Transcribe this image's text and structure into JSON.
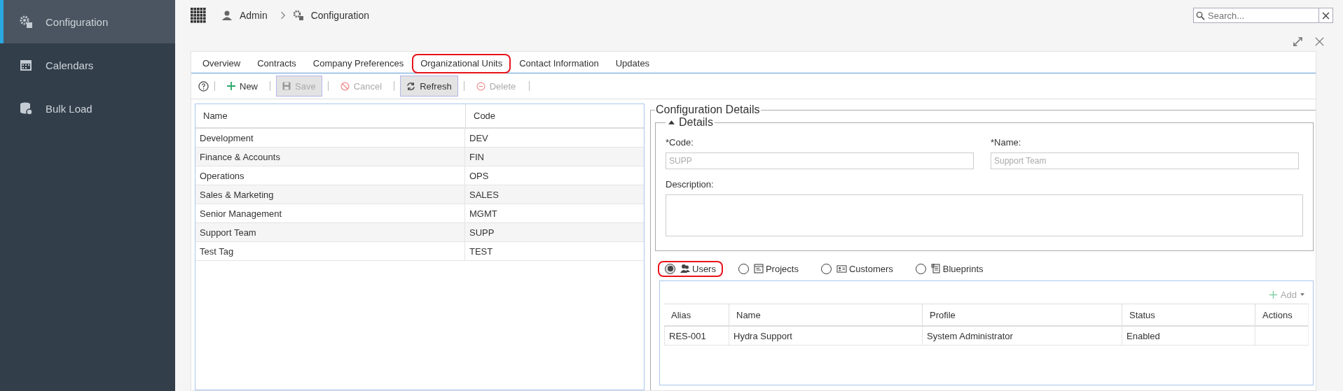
{
  "sidebar": {
    "items": [
      {
        "label": "Configuration",
        "selected": true
      },
      {
        "label": "Calendars",
        "selected": false
      },
      {
        "label": "Bulk Load",
        "selected": false
      }
    ]
  },
  "breadcrumb": [
    "Admin",
    "Configuration"
  ],
  "search": {
    "placeholder": "Search..."
  },
  "tabs": [
    {
      "label": "Overview",
      "selected": false
    },
    {
      "label": "Contracts",
      "selected": false
    },
    {
      "label": "Company Preferences",
      "selected": false
    },
    {
      "label": "Organizational Units",
      "selected": true
    },
    {
      "label": "Contact Information",
      "selected": false
    },
    {
      "label": "Updates",
      "selected": false
    }
  ],
  "toolbar": [
    {
      "kind": "help"
    },
    {
      "kind": "button",
      "label": "New",
      "disabled": false,
      "pressed": false
    },
    {
      "kind": "button",
      "label": "Save",
      "disabled": true,
      "pressed": true
    },
    {
      "kind": "button",
      "label": "Cancel",
      "disabled": true,
      "pressed": false
    },
    {
      "kind": "button",
      "label": "Refresh",
      "disabled": false,
      "pressed": true
    },
    {
      "kind": "button",
      "label": "Delete",
      "disabled": true,
      "pressed": false
    }
  ],
  "table": {
    "columns": [
      "Name",
      "Code"
    ],
    "rows": [
      [
        "Development",
        "DEV"
      ],
      [
        "Finance & Accounts",
        "FIN"
      ],
      [
        "Operations",
        "OPS"
      ],
      [
        "Sales & Marketing",
        "SALES"
      ],
      [
        "Senior Management",
        "MGMT"
      ],
      [
        "Support Team",
        "SUPP"
      ],
      [
        "Test Tag",
        "TEST"
      ]
    ]
  },
  "details": {
    "title": "Configuration Details",
    "section": "Details",
    "expanded": true,
    "code": {
      "label": "*Code:",
      "value": "SUPP"
    },
    "name": {
      "label": "*Name:",
      "value": "Support Team"
    },
    "description": {
      "label": "Description:"
    }
  },
  "related": [
    {
      "label": "Users",
      "selected": true
    },
    {
      "label": "Projects",
      "selected": false
    },
    {
      "label": "Customers",
      "selected": false
    },
    {
      "label": "Blueprints",
      "selected": false
    }
  ],
  "add_button": "Add",
  "users": {
    "columns": [
      "Alias",
      "Name",
      "Profile",
      "Status",
      "Actions"
    ],
    "rows": [
      [
        "RES-001",
        "Hydra Support",
        "System Administrator",
        "Enabled",
        ""
      ]
    ]
  }
}
